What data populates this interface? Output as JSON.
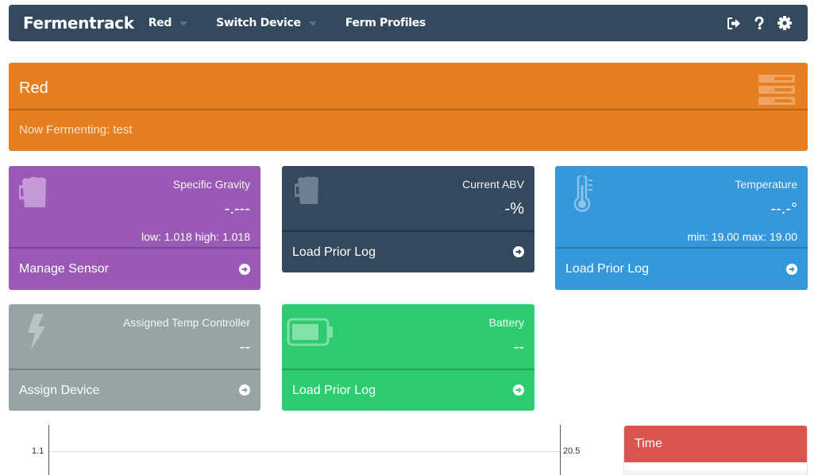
{
  "nav": {
    "brand": "Fermentrack",
    "device_menu": "Red",
    "switch_device": "Switch Device",
    "ferm_profiles": "Ferm Profiles",
    "icons": [
      "sign-out-icon",
      "question-icon",
      "gear-icon"
    ]
  },
  "device": {
    "name": "Red",
    "status": "Now Fermenting: test",
    "icon": "server-icon"
  },
  "tiles": {
    "gravity": {
      "title": "Specific Gravity",
      "value": "-.---",
      "extra": "low: 1.018 high: 1.018",
      "footer": "Manage Sensor",
      "icon": "beer-mug-icon"
    },
    "abv": {
      "title": "Current ABV",
      "value": "-%",
      "footer": "Load Prior Log",
      "icon": "beer-mug-icon"
    },
    "temperature": {
      "title": "Temperature",
      "value": "--.-°",
      "extra": "min: 19.00 max: 19.00",
      "footer": "Load Prior Log",
      "icon": "thermometer-icon"
    },
    "controller": {
      "title": "Assigned Temp Controller",
      "value": "--",
      "footer": "Assign Device",
      "icon": "bolt-icon"
    },
    "battery": {
      "title": "Battery",
      "value": "--",
      "footer": "Load Prior Log",
      "icon": "battery-icon"
    }
  },
  "chart": {
    "left_tick": "1.1",
    "right_tick": "20.5"
  },
  "time_panel": {
    "header": "Time"
  },
  "colors": {
    "navbar": "#34495e",
    "device": "#e67e22",
    "gravity": "#9b59b6",
    "abv": "#34495e",
    "temperature": "#3498db",
    "controller": "#95a5a6",
    "battery": "#2ecc71",
    "time_header": "#d9534f"
  }
}
